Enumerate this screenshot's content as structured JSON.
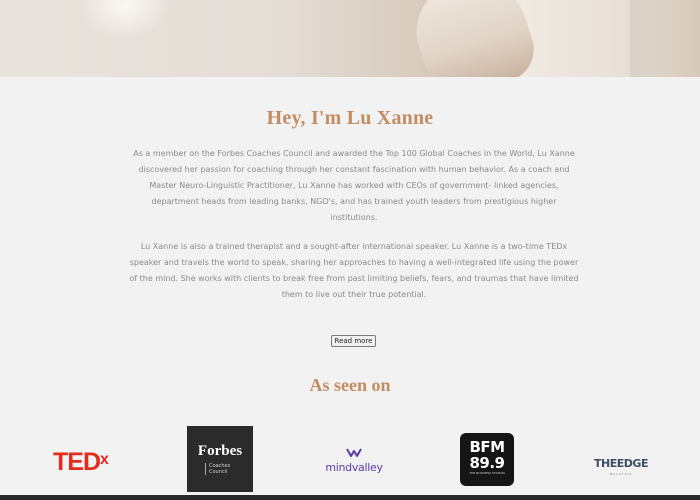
{
  "hero": {
    "image": "hero-photo"
  },
  "about": {
    "title": "Hey, I'm Lu Xanne",
    "paragraph1": "As a member on the Forbes Coaches Council and awarded the Top 100 Global Coaches in the World, Lu Xanne discovered her passion for coaching through her constant fascination with human behavior. As a coach and Master Neuro-Linguistic Practitioner, Lu Xanne has worked with CEOs of government- linked agencies, department heads from leading banks, NGO's, and has trained youth leaders from prestigious higher institutions.",
    "paragraph2": "Lu Xanne is also a trained therapist and a sought-after international speaker. Lu Xanne is a two-time TEDx speaker and travels the world to speak, sharing her approaches to having a well-integrated life using the power of the mind. She works with clients to break free from past limiting beliefs, fears, and traumas that have limited them to live out their true potential.",
    "read_more_label": "Read more"
  },
  "seen_on": {
    "title": "As seen on",
    "logos": {
      "tedx": {
        "main": "TED",
        "sup": "x"
      },
      "forbes": {
        "name": "Forbes",
        "sub": "Coaches Council"
      },
      "mindvalley": {
        "name": "mindvalley"
      },
      "bfm": {
        "line1": "BFM",
        "line2": "89.9",
        "tagline": "THE BUSINESS STATION"
      },
      "theedge": {
        "the": "THE",
        "edge": "EDGE",
        "sub": "MALAYSIA"
      }
    }
  },
  "colors": {
    "accent": "#c38c63",
    "body_text": "#8a8a8a",
    "tedx_red": "#e62b1e",
    "mindvalley_purple": "#5b3aa8",
    "theedge_navy": "#3c4d66"
  }
}
